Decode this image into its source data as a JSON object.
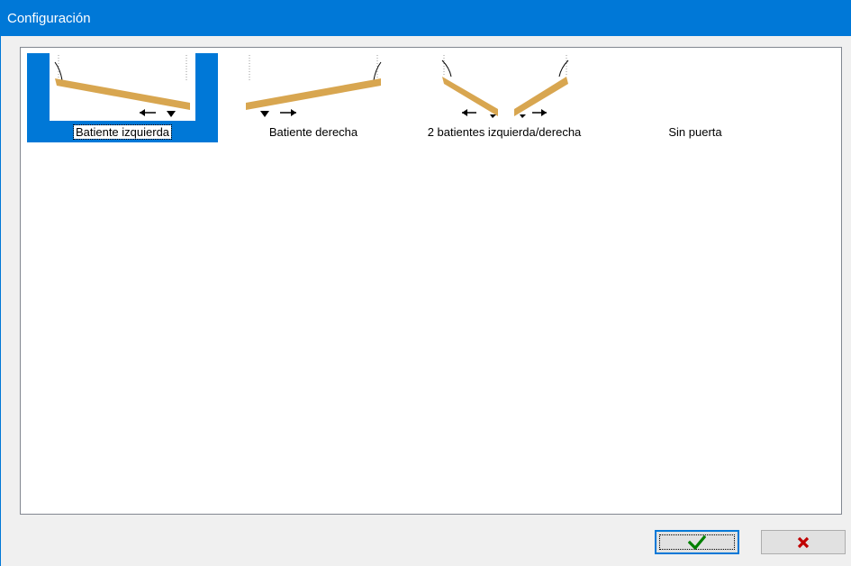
{
  "window": {
    "title": "Configuración"
  },
  "options": [
    {
      "label": "Batiente izquierda",
      "icon": "left-swing-door-icon",
      "selected": true
    },
    {
      "label": "Batiente derecha",
      "icon": "right-swing-door-icon",
      "selected": false
    },
    {
      "label": "2 batientes izquierda/derecha",
      "icon": "double-swing-door-icon",
      "selected": false
    },
    {
      "label": "Sin puerta",
      "icon": "",
      "selected": false
    }
  ],
  "buttons": {
    "ok": {
      "icon": "checkmark-icon",
      "color": "#008000"
    },
    "cancel": {
      "icon": "x-icon",
      "color": "#c00000"
    }
  },
  "colors": {
    "accent": "#0078d7",
    "door": "#d8a650"
  }
}
